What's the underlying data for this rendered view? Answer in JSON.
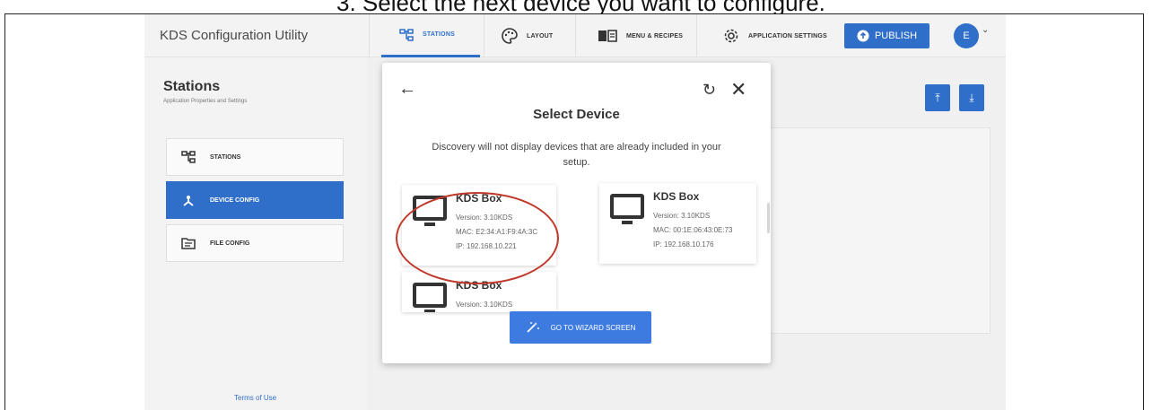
{
  "instruction": "3. Select the next device you want to configure.",
  "app": {
    "title": "KDS Configuration Utility",
    "nav": [
      {
        "label": "STATIONS",
        "icon": "stations-icon",
        "active": true
      },
      {
        "label": "LAYOUT",
        "icon": "palette-icon",
        "active": false
      },
      {
        "label": "MENU & RECIPES",
        "icon": "book-icon",
        "active": false
      },
      {
        "label": "APPLICATION SETTINGS",
        "icon": "gear-icon",
        "active": false
      }
    ],
    "publish_label": "PUBLISH",
    "avatar_initial": "E"
  },
  "sidebar": {
    "title": "Stations",
    "subtitle": "Application Properties and Settings",
    "items": [
      {
        "label": "STATIONS",
        "icon": "stations-icon",
        "active": false
      },
      {
        "label": "DEVICE CONFIG",
        "icon": "device-config-icon",
        "active": true
      },
      {
        "label": "FILE CONFIG",
        "icon": "file-config-icon",
        "active": false
      }
    ],
    "terms_label": "Terms of Use"
  },
  "modal": {
    "title": "Select Device",
    "description": "Discovery will not display devices that are already included in your setup.",
    "devices": [
      {
        "name": "KDS Box",
        "version": "Version: 3.10KDS",
        "mac": "MAC: E2:34:A1:F9:4A:3C",
        "ip": "IP: 192.168.10.221"
      },
      {
        "name": "KDS Box",
        "version": "Version: 3.10KDS",
        "mac": "MAC: 00:1E:06:43:0E:73",
        "ip": "IP: 192.168.10.176"
      },
      {
        "name": "KDS Box",
        "version": "Version: 3.10KDS",
        "mac": "",
        "ip": ""
      }
    ],
    "wizard_label": "GO TO WIZARD SCREEN"
  },
  "colors": {
    "accent": "#2f6fc9",
    "annotation": "#c0392b"
  }
}
